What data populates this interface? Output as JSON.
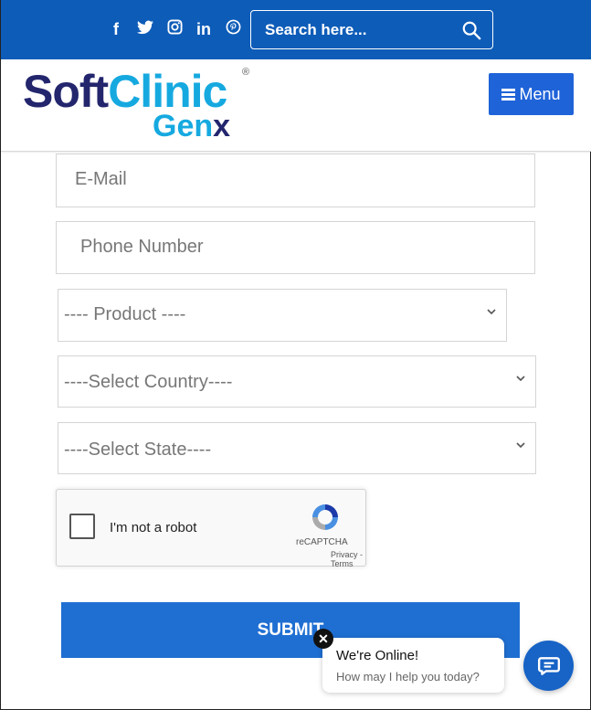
{
  "topbar": {
    "social": [
      {
        "icon": "facebook-icon",
        "glyph": "f"
      },
      {
        "icon": "twitter-icon",
        "glyph": "🐦"
      },
      {
        "icon": "instagram-icon",
        "glyph": "◎"
      },
      {
        "icon": "linkedin-icon",
        "glyph": "in"
      },
      {
        "icon": "pinterest-icon",
        "glyph": "℗"
      }
    ],
    "search_placeholder": "Search here..."
  },
  "header": {
    "logo_soft": "Soft",
    "logo_clinic": "Clinic",
    "logo_gen": "Gen",
    "logo_x": "x",
    "logo_reg": "®",
    "menu_label": "Menu"
  },
  "form": {
    "email_placeholder": "E-Mail",
    "phone_placeholder": "Phone Number",
    "product_selected": "---- Product ----",
    "country_selected": "----Select Country----",
    "state_selected": "----Select State----"
  },
  "captcha": {
    "label": "I'm not a robot",
    "brand": "reCAPTCHA",
    "privacy": "Privacy",
    "sep": " - ",
    "terms": "Terms"
  },
  "submit_label": "SUBMIT",
  "chat": {
    "title": "We're Online!",
    "subtitle": "How may I help you today?",
    "close": "✕"
  },
  "colors": {
    "brand_blue": "#0d5cb8",
    "button_blue": "#1f63d8",
    "logo_navy": "#23266d",
    "logo_cyan": "#16a9e0"
  }
}
